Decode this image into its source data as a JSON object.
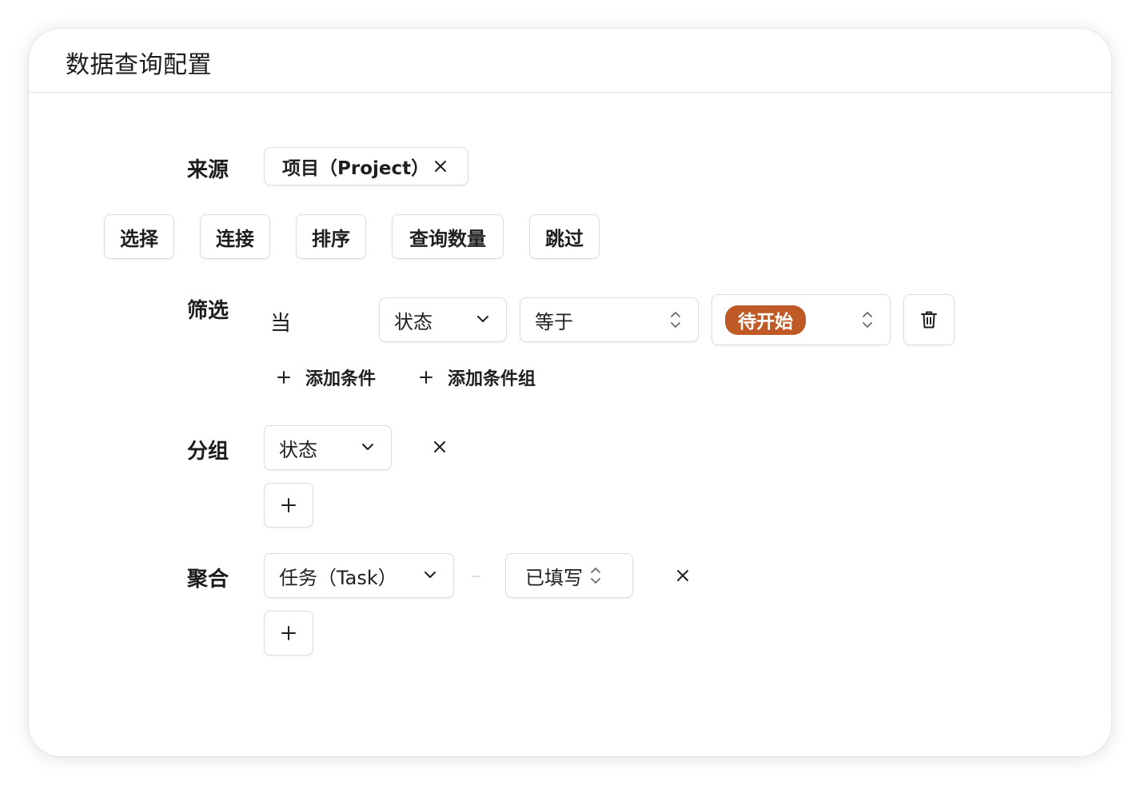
{
  "header": {
    "title": "数据查询配置"
  },
  "source": {
    "label": "来源",
    "chip": "项目（Project）",
    "remove_icon": "close-icon"
  },
  "actions": {
    "select": "选择",
    "join": "连接",
    "sort": "排序",
    "count": "查询数量",
    "skip": "跳过"
  },
  "filter": {
    "label": "筛选",
    "when": "当",
    "field": "状态",
    "operator": "等于",
    "value": "待开始",
    "value_color": "#bf5a26",
    "add_condition": "添加条件",
    "add_condition_group": "添加条件组",
    "delete_icon": "trash-icon"
  },
  "group": {
    "label": "分组",
    "field": "状态",
    "remove_icon": "close-icon",
    "add_icon": "plus-icon"
  },
  "aggregate": {
    "label": "聚合",
    "target": "任务（Task）",
    "separator": "–",
    "metric": "已填写",
    "remove_icon": "close-icon",
    "add_icon": "plus-icon"
  }
}
